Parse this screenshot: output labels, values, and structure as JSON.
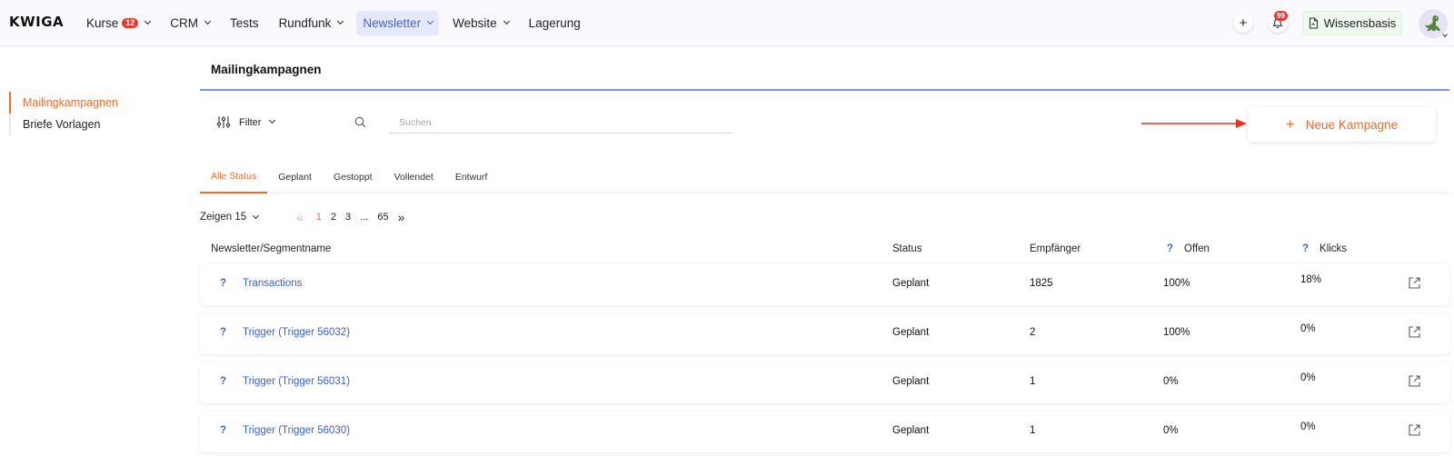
{
  "brand": {
    "logo_text": "KWIGA",
    "accent": "#f26b2a",
    "primary": "#3f64e0"
  },
  "topnav": {
    "items": [
      {
        "label": "Kurse",
        "badge": "12",
        "dropdown": true
      },
      {
        "label": "CRM",
        "dropdown": true
      },
      {
        "label": "Tests",
        "dropdown": false
      },
      {
        "label": "Rundfunk",
        "dropdown": true
      },
      {
        "label": "Newsletter",
        "dropdown": true,
        "active": true
      },
      {
        "label": "Website",
        "dropdown": true
      },
      {
        "label": "Lagerung",
        "dropdown": false
      }
    ],
    "add_icon": "plus-icon",
    "notifications": {
      "icon": "bell-icon",
      "count": "99"
    },
    "knowledge_base": {
      "label": "Wissensbasis",
      "icon": "document-icon"
    },
    "avatar_icon": "dinosaur-avatar-icon"
  },
  "sidebar": {
    "items": [
      {
        "label": "Mailingkampagnen",
        "active": true
      },
      {
        "label": "Briefe Vorlagen",
        "active": false
      }
    ]
  },
  "main": {
    "title": "Mailingkampagnen",
    "filter_label": "Filter",
    "search_placeholder": "Suchen",
    "new_campaign_label": "Neue Kampagne",
    "tabs": [
      {
        "label": "Alle Status",
        "active": true
      },
      {
        "label": "Geplant",
        "active": false
      },
      {
        "label": "Gestoppt",
        "active": false
      },
      {
        "label": "Vollendet",
        "active": false
      },
      {
        "label": "Entwurf",
        "active": false
      }
    ],
    "pagination": {
      "show_label": "Zeigen 15",
      "pages": [
        "1",
        "2",
        "3",
        "...",
        "65"
      ],
      "current": "1",
      "prev_icon": "double-chevron-left-icon",
      "next_icon": "double-chevron-right-icon"
    },
    "table": {
      "columns": {
        "name": "Newsletter/Segmentname",
        "status": "Status",
        "recipients": "Empfänger",
        "open": "Offen",
        "clicks": "Klicks",
        "help": "?"
      },
      "rows": [
        {
          "help": "?",
          "name": "Transactions",
          "status": "Geplant",
          "recipients": "1825",
          "open": "100%",
          "clicks": "18%"
        },
        {
          "help": "?",
          "name": "Trigger (Trigger 56032)",
          "status": "Geplant",
          "recipients": "2",
          "open": "100%",
          "clicks": "0%"
        },
        {
          "help": "?",
          "name": "Trigger (Trigger 56031)",
          "status": "Geplant",
          "recipients": "1",
          "open": "0%",
          "clicks": "0%"
        },
        {
          "help": "?",
          "name": "Trigger (Trigger 56030)",
          "status": "Geplant",
          "recipients": "1",
          "open": "0%",
          "clicks": "0%"
        }
      ]
    }
  }
}
